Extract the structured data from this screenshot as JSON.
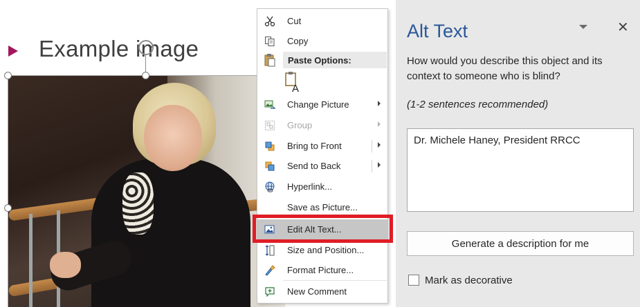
{
  "slide": {
    "title": "Example image",
    "colors": {
      "bullet": "#a3165d",
      "title": "#3f3f3f"
    }
  },
  "context_menu": {
    "items": [
      {
        "label": "Cut",
        "icon": "scissors-icon",
        "enabled": true,
        "submenu": false
      },
      {
        "label": "Copy",
        "icon": "copy-icon",
        "enabled": true,
        "submenu": false
      },
      {
        "label": "Paste Options:",
        "icon": "paste-icon",
        "header": true
      },
      {
        "label": "Change Picture",
        "icon": "change-picture-icon",
        "enabled": true,
        "submenu": true
      },
      {
        "label": "Group",
        "icon": "group-icon",
        "enabled": false,
        "submenu": true
      },
      {
        "label": "Bring to Front",
        "icon": "bring-to-front-icon",
        "enabled": true,
        "submenu": true
      },
      {
        "label": "Send to Back",
        "icon": "send-to-back-icon",
        "enabled": true,
        "submenu": true
      },
      {
        "label": "Hyperlink...",
        "icon": "hyperlink-icon",
        "enabled": true,
        "submenu": false
      },
      {
        "label": "Save as Picture...",
        "icon": "",
        "enabled": true,
        "submenu": false
      },
      {
        "label": "Edit Alt Text...",
        "icon": "edit-alt-text-icon",
        "enabled": true,
        "submenu": false,
        "highlighted": true
      },
      {
        "label": "Size and Position...",
        "icon": "size-position-icon",
        "enabled": true,
        "submenu": false
      },
      {
        "label": "Format Picture...",
        "icon": "format-picture-icon",
        "enabled": true,
        "submenu": false
      },
      {
        "label": "New Comment",
        "icon": "new-comment-icon",
        "enabled": true,
        "submenu": false
      }
    ],
    "highlight_color": "#e01d25"
  },
  "alt_text_pane": {
    "title": "Alt Text",
    "description": "How would you describe this object and its context to someone who is blind?",
    "hint": "(1-2 sentences recommended)",
    "textarea_value": "Dr. Michele Haney, President RRCC",
    "generate_button": "Generate a description for me",
    "decorative_label": "Mark as decorative",
    "decorative_checked": false,
    "colors": {
      "title": "#2b579a",
      "background": "#e8e8e8"
    }
  }
}
